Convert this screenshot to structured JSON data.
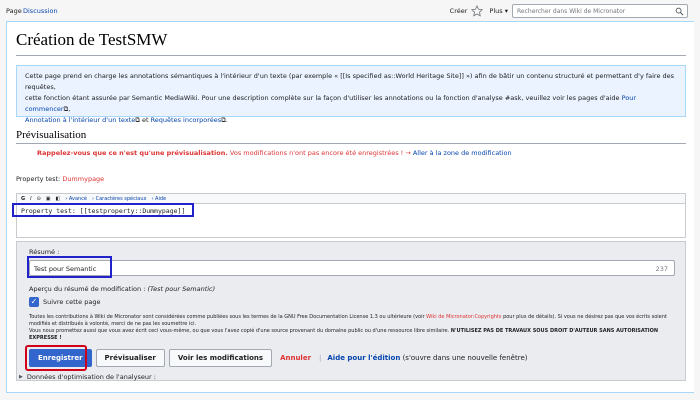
{
  "tabs": {
    "page": "Page",
    "discussion": "Discussion"
  },
  "tools": {
    "create": "Créer",
    "more": "Plus",
    "search_placeholder": "Rechercher dans Wiki de Micronator"
  },
  "title": "Création de TestSMW",
  "info": {
    "line1": "Cette page prend en charge les annotations sémantiques à l'intérieur d'un texte (par exemple « [[Is specified as::World Heritage Site]] ») afin de bâtir un contenu structuré et permettant d'y faire des requêtes,",
    "line2_pre": "cette fonction étant assurée par Semantic MediaWiki. Pour une description complète sur la façon d'utiliser les annotations ou la fonction d'analyse #ask, veuillez voir les pages d'aide ",
    "link_commencer": "Pour commencer",
    "link_annotation": "Annotation à l'intérieur d'un texte",
    "and": " et ",
    "link_requetes": "Requêtes incorporées"
  },
  "preview": {
    "heading": "Prévisualisation",
    "reminder": "Rappelez-vous que ce n'est qu'une prévisualisation.",
    "notsaved": " Vos modifications n'ont pas encore été enregistrées ! → ",
    "goto": "Aller à la zone de modification"
  },
  "property_output": {
    "label": "Property test: ",
    "value": "Dummypage"
  },
  "editor": {
    "toolbar": {
      "bold": "G",
      "italic": "I",
      "advanced": "› Avancé",
      "special": "› Caractères spéciaux",
      "help": "› Aide"
    },
    "text": "Property test:  [[testproperty::Dummypage]]"
  },
  "summary": {
    "label": "Résumé :",
    "value": "Test pour Semantic",
    "count": "237",
    "preview_label": "Aperçu du résumé de modification : ",
    "preview_value": "(Test pour Semantic)",
    "watch_label": "Suivre cette page"
  },
  "legal": {
    "p1_pre": "Toutes les contributions à Wiki de Micronator sont considérées comme publiées sous les termes de la GNU Free Documentation License 1.3 ou ultérieure (voir ",
    "p1_link": "Wiki de Micronator:Copyrights",
    "p1_post": " pour plus de détails). Si vous ne désirez pas que vos écrits soient modifiés et distribués à volonté, merci de ne pas les soumettre ici.",
    "p2": "Vous nous promettez aussi que vous avez écrit ceci vous-même, ou que vous l'avez copié d'une source provenant du domaine public ou d'une ressource libre similaire. ",
    "p2_bold": "N'UTILISEZ PAS DE TRAVAUX SOUS DROIT D'AUTEUR SANS AUTORISATION EXPRESSE !"
  },
  "buttons": {
    "save": "Enregistrer",
    "preview": "Prévisualiser",
    "diff": "Voir les modifications",
    "cancel": "Annuler",
    "separator": "|",
    "help_link": "Aide pour l'édition",
    "help_note": " (s'ouvre dans une nouvelle fenêtre)"
  },
  "parser": "Données d'optimisation de l'analyseur :",
  "colors": {
    "accent": "#3366cc",
    "highlight_blue": "#2222cc",
    "highlight_red": "#d0021b"
  }
}
